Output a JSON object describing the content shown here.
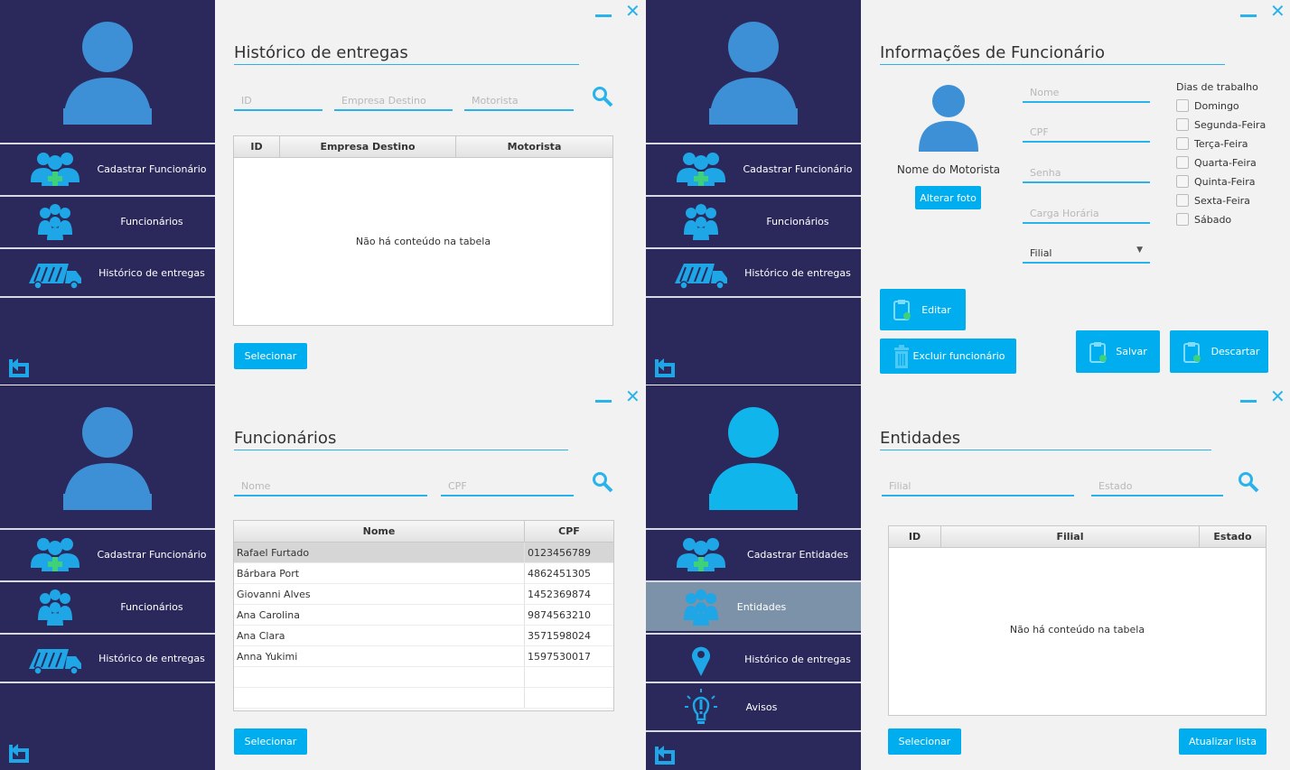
{
  "colors": {
    "sidebar": "#2b285c",
    "accent": "#00adef",
    "active_item": "#7c92a9"
  },
  "p1": {
    "title": "Histórico de entregas",
    "menu": [
      "Cadastrar Funcionário",
      "Funcionários",
      "Histórico de entregas"
    ],
    "fields": {
      "id": "ID",
      "empresa": "Empresa Destino",
      "motorista": "Motorista"
    },
    "columns": [
      "ID",
      "Empresa Destino",
      "Motorista"
    ],
    "empty": "Não há conteúdo na tabela",
    "select_btn": "Selecionar"
  },
  "p2": {
    "title": "Informações de Funcionário",
    "menu": [
      "Cadastrar Funcionário",
      "Funcionários",
      "Histórico de entregas"
    ],
    "driver_name": "Nome do Motorista",
    "change_photo": "Alterar foto",
    "fields": {
      "nome": "Nome",
      "cpf": "CPF",
      "senha": "Senha",
      "carga": "Carga Horária",
      "filial": "Filial"
    },
    "days_title": "Dias de trabalho",
    "days": [
      "Domingo",
      "Segunda-Feira",
      "Terça-Feira",
      "Quarta-Feira",
      "Quinta-Feira",
      "Sexta-Feira",
      "Sábado"
    ],
    "edit_btn": "Editar",
    "delete_btn": "Excluir funcionário",
    "save_btn": "Salvar",
    "discard_btn": "Descartar"
  },
  "p3": {
    "title": "Funcionários",
    "menu": [
      "Cadastrar Funcionário",
      "Funcionários",
      "Histórico de entregas"
    ],
    "fields": {
      "nome": "Nome",
      "cpf": "CPF"
    },
    "columns": [
      "Nome",
      "CPF"
    ],
    "rows": [
      [
        "Rafael Furtado",
        "0123456789"
      ],
      [
        "Bárbara Port",
        "4862451305"
      ],
      [
        "Giovanni Alves",
        "1452369874"
      ],
      [
        "Ana Carolina",
        "9874563210"
      ],
      [
        "Ana Clara",
        "3571598024"
      ],
      [
        "Anna Yukimi",
        "1597530017"
      ]
    ],
    "select_btn": "Selecionar"
  },
  "p4": {
    "title": "Entidades",
    "menu": [
      "Cadastrar Entidades",
      "Entidades",
      "Histórico de entregas",
      "Avisos"
    ],
    "fields": {
      "filial": "Filial",
      "estado": "Estado"
    },
    "columns": [
      "ID",
      "Filial",
      "Estado"
    ],
    "empty": "Não há conteúdo na tabela",
    "select_btn": "Selecionar",
    "refresh_btn": "Atualizar lista"
  }
}
